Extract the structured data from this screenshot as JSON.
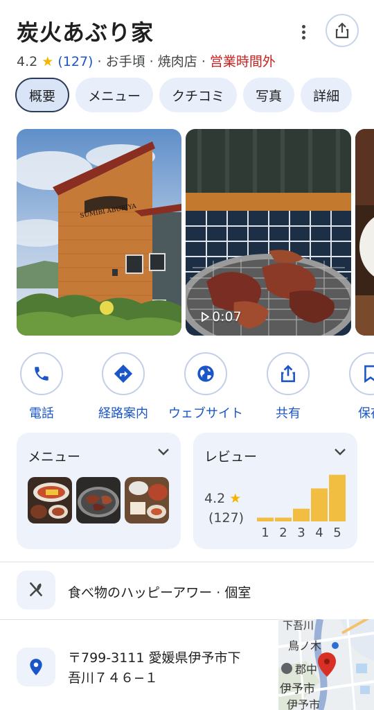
{
  "header": {
    "title": "炭火あぶり家",
    "rating": "4.2",
    "review_count": "(127)",
    "separator": "·",
    "price": "お手頃",
    "category": "焼肉店",
    "status": "営業時間外",
    "status_color": "#c5221f"
  },
  "tabs": [
    {
      "label": "概要",
      "active": true
    },
    {
      "label": "メニュー"
    },
    {
      "label": "クチコミ"
    },
    {
      "label": "写真"
    },
    {
      "label": "詳細"
    }
  ],
  "photos": {
    "storefront_sign": "SUMIBI ABURIYA",
    "video_duration": "0:07"
  },
  "actions": [
    {
      "label": "電話",
      "icon": "phone-icon"
    },
    {
      "label": "経路案内",
      "icon": "directions-icon"
    },
    {
      "label": "ウェブサイト",
      "icon": "globe-icon"
    },
    {
      "label": "共有",
      "icon": "share-icon"
    },
    {
      "label": "保存",
      "icon": "bookmark-icon"
    }
  ],
  "menu_card": {
    "title": "メニュー"
  },
  "review_card": {
    "title": "レビュー",
    "rating": "4.2",
    "count": "(127)",
    "bars": [
      {
        "label": "1",
        "fraction": 0.08
      },
      {
        "label": "2",
        "fraction": 0.08
      },
      {
        "label": "3",
        "fraction": 0.27
      },
      {
        "label": "4",
        "fraction": 0.7
      },
      {
        "label": "5",
        "fraction": 0.99
      }
    ],
    "bar_color": "#f2be42"
  },
  "features": {
    "text": "食べ物のハッピーアワー · 個室",
    "icon": "utensils-icon"
  },
  "address": {
    "line1": "〒799-3111 愛媛県伊予市下",
    "line2": "吾川７４６−１",
    "icon": "location-pin-icon"
  },
  "map": {
    "labels": [
      "下吾川",
      "鳥ノ木",
      "郡中",
      "伊予市",
      "伊予市"
    ]
  },
  "colors": {
    "accent": "#1a56c7",
    "chip_bg": "#e8effb",
    "card_bg": "#eef3fb",
    "star": "#f5b400"
  }
}
